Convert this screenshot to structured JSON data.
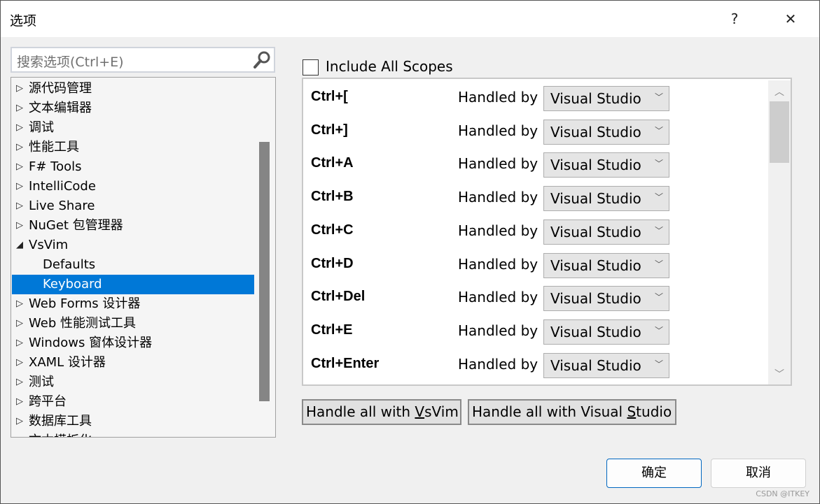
{
  "window": {
    "title": "选项",
    "help": "?",
    "close": "✕"
  },
  "search": {
    "placeholder": "搜索选项(Ctrl+E)"
  },
  "tree": [
    {
      "label": "源代码管理",
      "expander": "collapsed"
    },
    {
      "label": "文本编辑器",
      "expander": "collapsed"
    },
    {
      "label": "调试",
      "expander": "collapsed"
    },
    {
      "label": "性能工具",
      "expander": "collapsed"
    },
    {
      "label": "F# Tools",
      "expander": "collapsed"
    },
    {
      "label": "IntelliCode",
      "expander": "collapsed"
    },
    {
      "label": "Live Share",
      "expander": "collapsed"
    },
    {
      "label": "NuGet 包管理器",
      "expander": "collapsed"
    },
    {
      "label": "VsVim",
      "expander": "expanded"
    },
    {
      "label": "Defaults",
      "expander": "none"
    },
    {
      "label": "Keyboard",
      "expander": "none",
      "selected": true
    },
    {
      "label": "Web Forms 设计器",
      "expander": "collapsed"
    },
    {
      "label": "Web 性能测试工具",
      "expander": "collapsed"
    },
    {
      "label": "Windows 窗体设计器",
      "expander": "collapsed"
    },
    {
      "label": "XAML 设计器",
      "expander": "collapsed"
    },
    {
      "label": "测试",
      "expander": "collapsed"
    },
    {
      "label": "跨平台",
      "expander": "collapsed"
    },
    {
      "label": "数据库工具",
      "expander": "collapsed"
    },
    {
      "label": "文本模板化",
      "expander": "collapsed"
    }
  ],
  "include_all_scopes": {
    "label": "Include All Scopes",
    "checked": false
  },
  "bindings": [
    {
      "key": "Ctrl+[",
      "handled_by": "Handled by",
      "value": "Visual Studio"
    },
    {
      "key": "Ctrl+]",
      "handled_by": "Handled by",
      "value": "Visual Studio"
    },
    {
      "key": "Ctrl+A",
      "handled_by": "Handled by",
      "value": "Visual Studio"
    },
    {
      "key": "Ctrl+B",
      "handled_by": "Handled by",
      "value": "Visual Studio"
    },
    {
      "key": "Ctrl+C",
      "handled_by": "Handled by",
      "value": "Visual Studio"
    },
    {
      "key": "Ctrl+D",
      "handled_by": "Handled by",
      "value": "Visual Studio"
    },
    {
      "key": "Ctrl+Del",
      "handled_by": "Handled by",
      "value": "Visual Studio"
    },
    {
      "key": "Ctrl+E",
      "handled_by": "Handled by",
      "value": "Visual Studio"
    },
    {
      "key": "Ctrl+Enter",
      "handled_by": "Handled by",
      "value": "Visual Studio"
    }
  ],
  "buttons": {
    "vsvim": {
      "pre": "Handle all with ",
      "u": "V",
      "post": "sVim"
    },
    "vs": {
      "pre": "Handle all with Visual ",
      "u": "S",
      "post": "tudio"
    },
    "ok": "确定",
    "cancel": "取消"
  },
  "watermark": "CSDN @ITKEY",
  "colors": {
    "selection": "#0078d7",
    "primary_border": "#0067c0"
  }
}
